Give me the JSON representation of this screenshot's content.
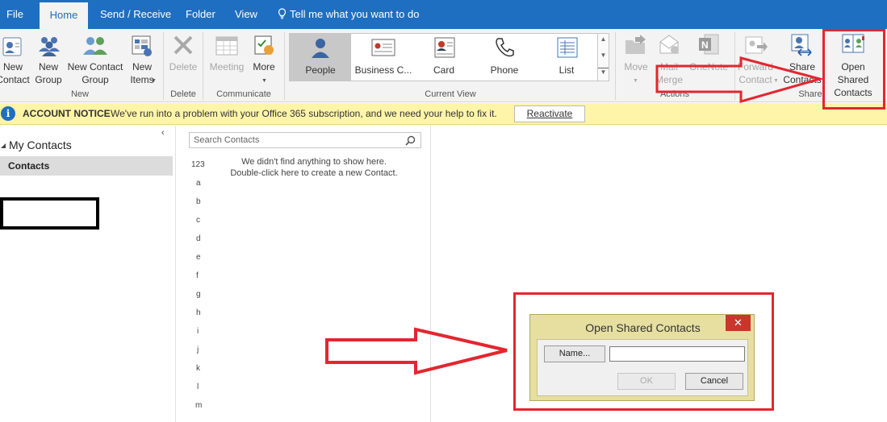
{
  "tabs": [
    {
      "label": "File"
    },
    {
      "label": "Home"
    },
    {
      "label": "Send / Receive"
    },
    {
      "label": "Folder"
    },
    {
      "label": "View"
    }
  ],
  "tell_me": "Tell me what you want to do",
  "ribbon": {
    "new_contact": "New\nContact",
    "new_group": "New\nGroup",
    "new_contact_group": "New Contact\nGroup",
    "new_items": "New\nItems",
    "group_new": "New",
    "delete": "Delete",
    "group_delete": "Delete",
    "meeting": "Meeting",
    "more": "More",
    "group_communicate": "Communicate",
    "views": [
      {
        "label": "People"
      },
      {
        "label": "Business C..."
      },
      {
        "label": "Card"
      },
      {
        "label": "Phone"
      },
      {
        "label": "List"
      }
    ],
    "group_current_view": "Current View",
    "move": "Move",
    "mail_merge": "Mail\nMerge",
    "onenote": "OneNote",
    "group_actions": "Actions",
    "forward_contact": "Forward\nContact",
    "share_contacts": "Share\nContacts",
    "open_shared_contacts": "Open Shared\nContacts",
    "group_share": "Share"
  },
  "notice": {
    "title": "ACCOUNT NOTICE",
    "text": "We've run into a problem with your Office 365 subscription, and we need your help to fix it.",
    "button": "Reactivate"
  },
  "left_pane": {
    "collapse_glyph": "‹",
    "heading": "My Contacts",
    "folder": "Contacts"
  },
  "middle_pane": {
    "search_placeholder": "Search Contacts",
    "empty_line1": "We didn't find anything to show here.",
    "empty_line2": "Double-click here to create a new Contact.",
    "alphabet": [
      "123",
      "a",
      "b",
      "c",
      "d",
      "e",
      "f",
      "g",
      "h",
      "i",
      "j",
      "k",
      "l",
      "m"
    ]
  },
  "dialog": {
    "title": "Open Shared Contacts",
    "close": "✕",
    "name_button": "Name...",
    "name_value": "",
    "ok": "OK",
    "cancel": "Cancel"
  },
  "colors": {
    "accent": "#1e6fc1",
    "annotation_red": "#e3262f",
    "notice_bg": "#fff5a8",
    "dialog_bg": "#e6dfa0"
  }
}
